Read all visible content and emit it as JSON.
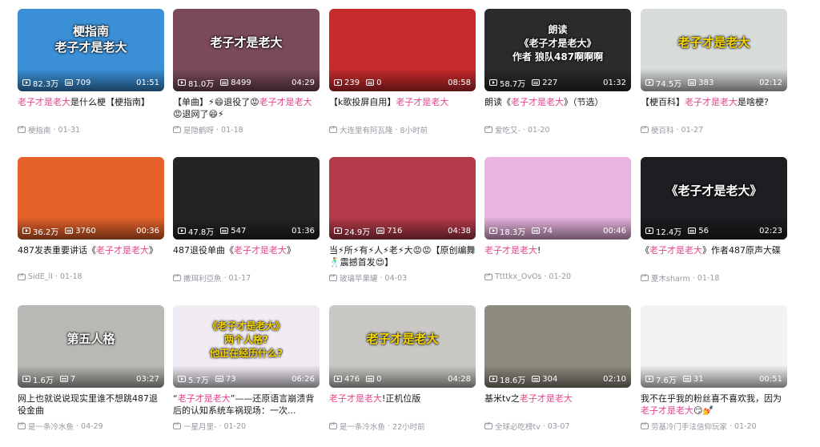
{
  "videos": [
    {
      "title_hl": "老子才是老大",
      "title_rest": "是什么梗【梗指南】",
      "overlay": "梗指南\n老子才是老大",
      "views": "82.3万",
      "danmaku": "709",
      "duration": "01:51",
      "author": "梗指南",
      "date": "01-31",
      "bg": "#3a8fd6"
    },
    {
      "title_hl": "【单曲】⚡😄退役了😡老子才是老大😡退网了😄⚡",
      "title_rest": "",
      "overlay": "老子才是老大",
      "views": "81.0万",
      "danmaku": "8499",
      "duration": "04:29",
      "author": "是隐鹤呀",
      "date": "01-18",
      "bg": "#7a4a5a"
    },
    {
      "title_hl": "【k歌投屏自用】",
      "title_rest": "老子才是老大",
      "overlay": "",
      "views": "239",
      "danmaku": "0",
      "duration": "08:58",
      "author": "大连里有阿瓦隆",
      "date": "8小时前",
      "bg": "#c72b2b"
    },
    {
      "title_hl": "朗读《",
      "title_rest": "老子才是老大》（节选）",
      "overlay": "朗读\n《老子才是老大》\n作者 狼队487啊啊啊",
      "views": "58.7万",
      "danmaku": "227",
      "duration": "01:32",
      "author": "爱吃又-",
      "date": "01-20",
      "bg": "#2b2b2b"
    },
    {
      "title_hl": "【梗百科】",
      "title_rest": "老子才是老大是啥梗?",
      "overlay": "老子才是老大",
      "views": "74.5万",
      "danmaku": "383",
      "duration": "02:12",
      "author": "梗百科",
      "date": "01-27",
      "bg": "#d8dcd8"
    },
    {
      "title_hl": "487发表重要讲话《",
      "title_rest": "老子才是老大》",
      "overlay": "",
      "views": "36.2万",
      "danmaku": "3760",
      "duration": "00:36",
      "author": "SidE_lI",
      "date": "01-18",
      "bg": "#e6622a"
    },
    {
      "title_hl": "487退役单曲《",
      "title_rest": "老子才是老大》",
      "overlay": "",
      "views": "47.8万",
      "danmaku": "547",
      "duration": "01:36",
      "author": "撒珥利亞魚",
      "date": "01-17",
      "bg": "#262422"
    },
    {
      "title_hl": "当⚡所⚡有⚡人⚡老⚡大😡😡【原创编舞🕺震撼首发😍】",
      "title_rest": "",
      "overlay": "",
      "views": "24.9万",
      "danmaku": "716",
      "duration": "04:38",
      "author": "玻璃苹果罐",
      "date": "04-03",
      "bg": "#b53a4a"
    },
    {
      "title_hl": "",
      "title_rest": "老子才是老大!",
      "overlay": "",
      "views": "18.3万",
      "danmaku": "74",
      "duration": "00:46",
      "author": "Ttttkx_OvOs",
      "date": "01-20",
      "bg": "#e9b4df"
    },
    {
      "title_hl": "《",
      "title_rest": "老子才是老大》作者487原声大碟",
      "overlay": "《老子才是老大》",
      "views": "12.4万",
      "danmaku": "56",
      "duration": "02:23",
      "author": "夏木sharm",
      "date": "01-18",
      "bg": "#1e1e22"
    },
    {
      "title_hl": "网上也就说说现实里谁不想跳487退役金曲",
      "title_rest": "",
      "overlay": "第五人格",
      "views": "1.6万",
      "danmaku": "7",
      "duration": "03:27",
      "author": "是一条冷水鱼",
      "date": "04-29",
      "bg": "#b8b8b4"
    },
    {
      "title_hl": "“",
      "title_rest": "老子才是老大”——还原语言崩溃背后的认知系统车祸现场：一次...",
      "overlay": "《老子才是老大》\n两个人格?\n他正在经历什么?",
      "views": "5.7万",
      "danmaku": "73",
      "duration": "06:26",
      "author": "一星月里-",
      "date": "01-20",
      "bg": "#f1ecf4"
    },
    {
      "title_hl": "老子才是老大!",
      "title_rest": "正机位版",
      "overlay": "老子才是老大",
      "views": "476",
      "danmaku": "0",
      "duration": "04:28",
      "author": "是一条冷水鱼",
      "date": "22小时前",
      "bg": "#c9c8c4"
    },
    {
      "title_hl": "基米tv之",
      "title_rest": "老子才是老大",
      "overlay": "",
      "views": "18.6万",
      "danmaku": "304",
      "duration": "02:10",
      "author": "全球必吃榜tv",
      "date": "03-07",
      "bg": "#8e8a7e"
    },
    {
      "title_hl": "我不在乎我的粉丝喜不喜欢我，因为",
      "title_rest": "老子才是老大😏💅",
      "overlay": "",
      "views": "7.6万",
      "danmaku": "31",
      "duration": "00:51",
      "author": "劳基冷门手法信仰玩家",
      "date": "01-20",
      "bg": "#f2f2f2"
    }
  ]
}
